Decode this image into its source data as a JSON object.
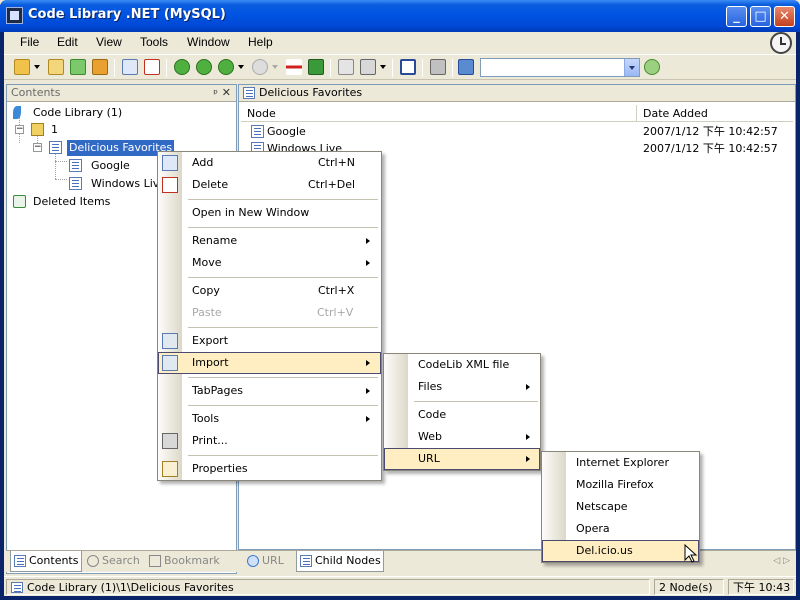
{
  "window": {
    "title": "Code Library .NET (MySQL)",
    "min_label": "_",
    "max_label": "□",
    "close_label": "✕"
  },
  "menubar": {
    "items": [
      "File",
      "Edit",
      "View",
      "Tools",
      "Window",
      "Help"
    ]
  },
  "left_panel": {
    "title": "Contents",
    "pin": "ᵖ",
    "close": "✕",
    "tree": {
      "root": "Code Library (1)",
      "node1": "1",
      "selected": "Delicious Favorites",
      "child1": "Google",
      "child2": "Windows Live",
      "deleted": "Deleted Items"
    },
    "tabs": [
      "Contents",
      "Search",
      "Bookmark"
    ]
  },
  "right_panel": {
    "title": "Delicious Favorites",
    "columns": [
      "Node",
      "Date Added"
    ],
    "rows": [
      {
        "name": "Google",
        "date": "2007/1/12 下午 10:42:57"
      },
      {
        "name": "Windows Live",
        "date": "2007/1/12 下午 10:42:57"
      }
    ],
    "tabs": [
      "URL",
      "Child Nodes"
    ]
  },
  "context_menu": {
    "items": [
      {
        "label": "Add",
        "shortcut": "Ctrl+N"
      },
      {
        "label": "Delete",
        "shortcut": "Ctrl+Del"
      },
      {
        "label": "Open in New Window",
        "shortcut": ""
      },
      {
        "label": "Rename",
        "shortcut": ""
      },
      {
        "label": "Move",
        "shortcut": ""
      },
      {
        "label": "Copy",
        "shortcut": "Ctrl+X"
      },
      {
        "label": "Paste",
        "shortcut": "Ctrl+V"
      },
      {
        "label": "Export",
        "shortcut": ""
      },
      {
        "label": "Import",
        "shortcut": ""
      },
      {
        "label": "TabPages",
        "shortcut": ""
      },
      {
        "label": "Tools",
        "shortcut": ""
      },
      {
        "label": "Print...",
        "shortcut": ""
      },
      {
        "label": "Properties",
        "shortcut": ""
      }
    ]
  },
  "import_menu": {
    "items": [
      "CodeLib XML file",
      "Files",
      "Code",
      "Web",
      "URL"
    ]
  },
  "url_menu": {
    "items": [
      "Internet Explorer",
      "Mozilla Firefox",
      "Netscape",
      "Opera",
      "Del.icio.us"
    ]
  },
  "statusbar": {
    "path": "Code Library (1)\\1\\Delicious Favorites",
    "count": "2 Node(s)",
    "time": "下午 10:43"
  },
  "colors": {
    "title_blue": "#0054E3",
    "highlight": "#FFEEC2",
    "selection": "#316AC5"
  }
}
